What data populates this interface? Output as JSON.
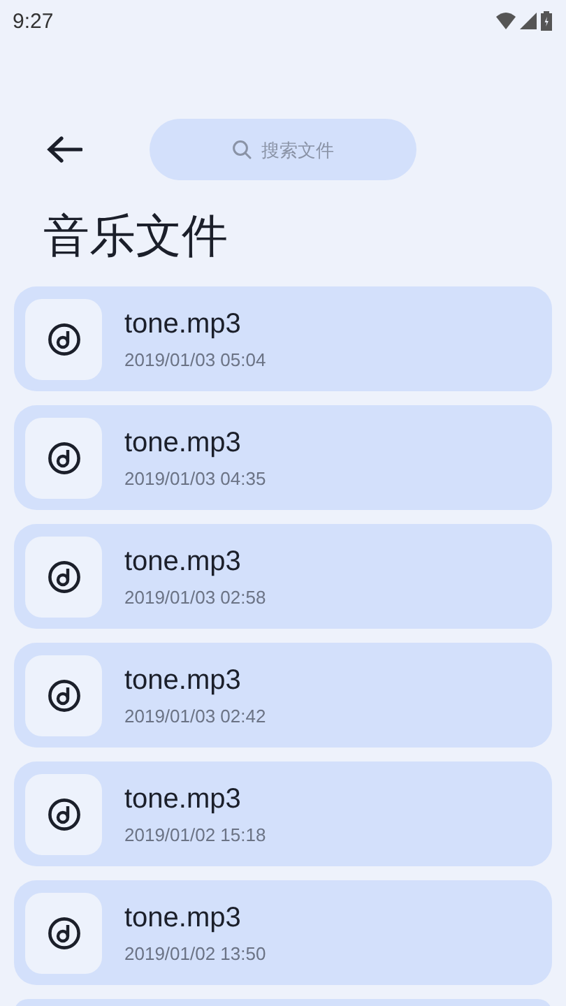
{
  "status_bar": {
    "time": "9:27"
  },
  "search": {
    "placeholder": "搜索文件"
  },
  "title": "音乐文件",
  "files": [
    {
      "name": "tone.mp3",
      "date": "2019/01/03 05:04"
    },
    {
      "name": "tone.mp3",
      "date": "2019/01/03 04:35"
    },
    {
      "name": "tone.mp3",
      "date": "2019/01/03 02:58"
    },
    {
      "name": "tone.mp3",
      "date": "2019/01/03 02:42"
    },
    {
      "name": "tone.mp3",
      "date": "2019/01/02 15:18"
    },
    {
      "name": "tone.mp3",
      "date": "2019/01/02 13:50"
    }
  ]
}
